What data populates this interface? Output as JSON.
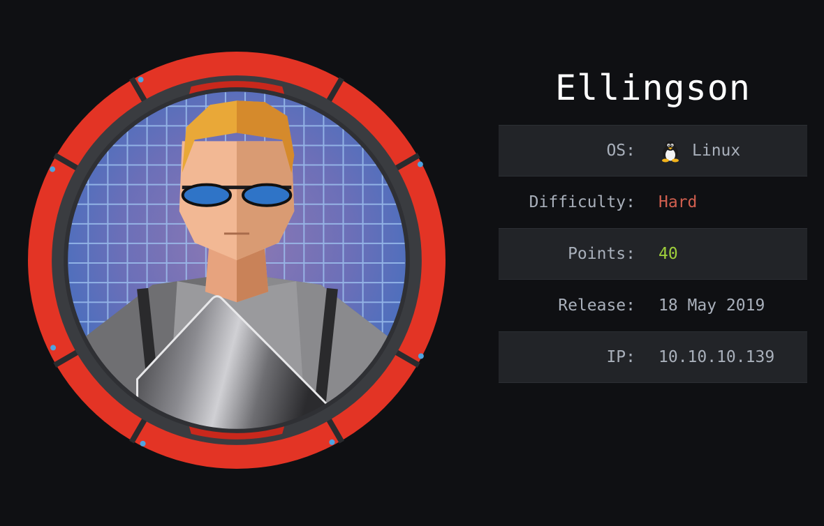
{
  "machine": {
    "name": "Ellingson"
  },
  "info": [
    {
      "label": "OS:",
      "value": "Linux",
      "icon": "tux-penguin-icon",
      "style": "normal"
    },
    {
      "label": "Difficulty:",
      "value": "Hard",
      "style": "hard"
    },
    {
      "label": "Points:",
      "value": "40",
      "style": "pts"
    },
    {
      "label": "Release:",
      "value": "18 May 2019",
      "style": "normal"
    },
    {
      "label": "IP:",
      "value": "10.10.10.139",
      "style": "normal"
    }
  ],
  "colors": {
    "background": "#0f1013",
    "row_shade": "#222428",
    "label": "#a9b0bb",
    "difficulty_hard": "#d15f4f",
    "points": "#9fcf3b",
    "ring_red": "#e33425"
  }
}
